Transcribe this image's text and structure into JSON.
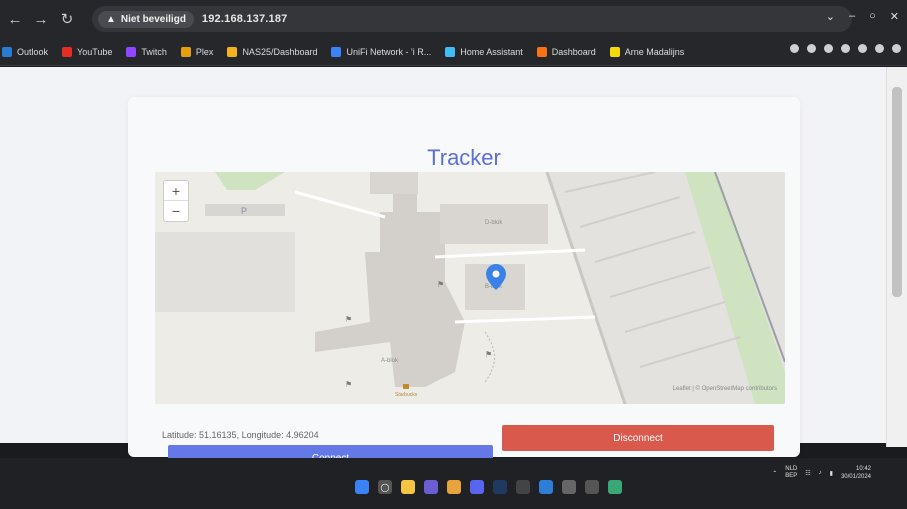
{
  "browser": {
    "security_label": "Niet beveiligd",
    "url": "192.168.137.187",
    "bookmarks": [
      {
        "label": "Outlook",
        "icon": "outlook-icon",
        "color": "#2a7bd4"
      },
      {
        "label": "YouTube",
        "icon": "youtube-icon",
        "color": "#e52d27"
      },
      {
        "label": "Twitch",
        "icon": "twitch-icon",
        "color": "#9146ff"
      },
      {
        "label": "Plex",
        "icon": "plex-icon",
        "color": "#e5a00d"
      },
      {
        "label": "NAS25/Dashboard",
        "icon": "nas-icon",
        "color": "#f6b21a"
      },
      {
        "label": "UniFi Network - 'i R...",
        "icon": "unifi-icon",
        "color": "#3b82f6"
      },
      {
        "label": "Home Assistant",
        "icon": "home-assistant-icon",
        "color": "#41bdf5"
      },
      {
        "label": "Dashboard",
        "icon": "dashboard-icon",
        "color": "#f97316"
      },
      {
        "label": "Arne Madalijns",
        "icon": "bookmark-icon",
        "color": "#f5d90a"
      }
    ]
  },
  "page": {
    "title": "Tracker",
    "map": {
      "labels": {
        "d_blok": "D-blok",
        "b_blok": "B-blok",
        "a_blok": "A-blok",
        "starbucks": "Starbucks",
        "parking": "P"
      },
      "zoom_in": "+",
      "zoom_out": "−",
      "attribution": "Leaflet | © OpenStreetMap contributors"
    },
    "coords_text": "Latitude: 51.16135, Longitude: 4.96204",
    "connect_label": "Connect",
    "disconnect_label": "Disconnect"
  },
  "taskbar": {
    "lang_line1": "NLD",
    "lang_line2": "BEP",
    "time": "10:42",
    "date": "30/01/2024"
  },
  "colors": {
    "accent": "#5b6fd6",
    "connect": "#6479e6",
    "disconnect": "#d9594d"
  }
}
